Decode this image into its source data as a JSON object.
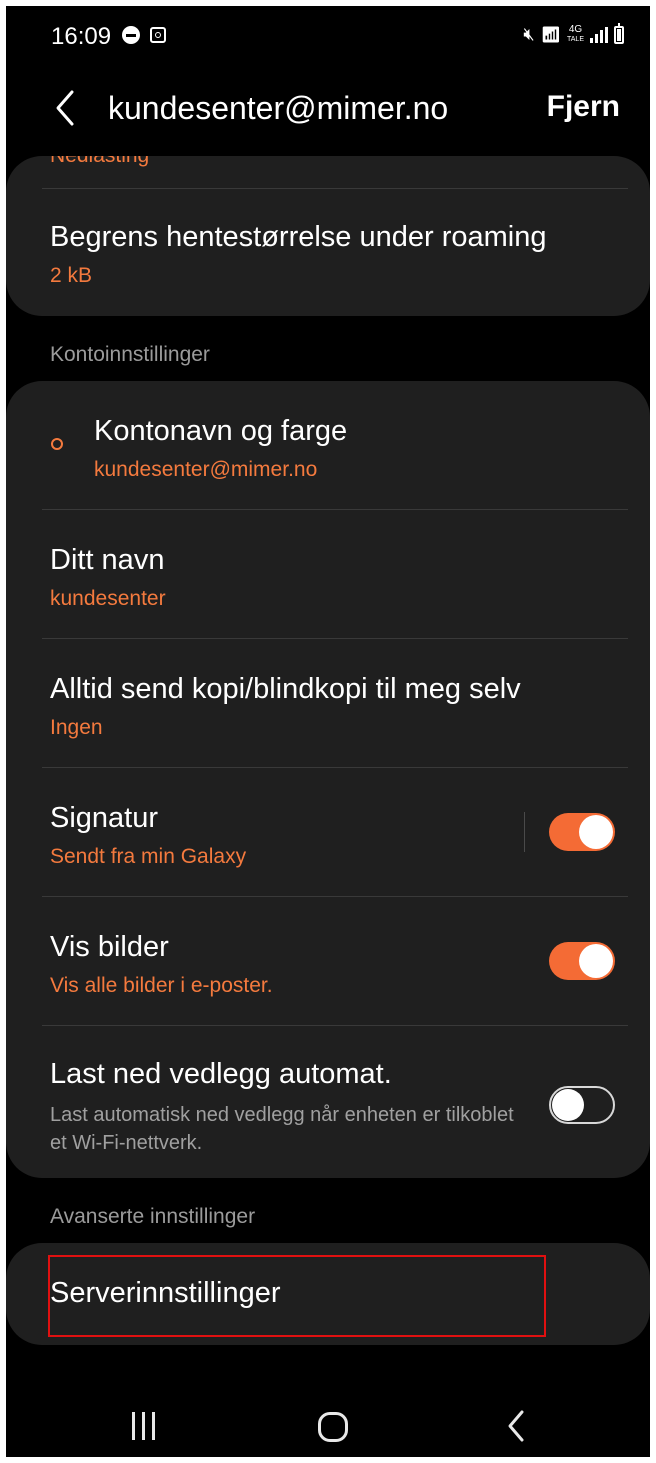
{
  "status_bar": {
    "time": "16:09",
    "network_label_top": "4G",
    "network_label_bottom": "TALE"
  },
  "header": {
    "title": "kundesenter@mimer.no",
    "remove_label": "Fjern"
  },
  "top_card": {
    "partial_row_text": "Nedlasting",
    "roaming_row": {
      "title": "Begrens hentestørrelse under roaming",
      "value": "2 kB"
    }
  },
  "account_section": {
    "header": "Kontoinnstillinger",
    "rows": [
      {
        "title": "Kontonavn og farge",
        "value": "kundesenter@mimer.no"
      },
      {
        "title": "Ditt navn",
        "value": "kundesenter"
      },
      {
        "title": "Alltid send kopi/blindkopi til meg selv",
        "value": "Ingen"
      },
      {
        "title": "Signatur",
        "value": "Sendt fra min Galaxy",
        "toggle": "on"
      },
      {
        "title": "Vis bilder",
        "value": "Vis alle bilder i e-poster.",
        "toggle": "on"
      },
      {
        "title": "Last ned vedlegg automat.",
        "value": "Last automatisk ned vedlegg når enheten er tilkoblet et Wi-Fi-nettverk.",
        "toggle": "off"
      }
    ]
  },
  "advanced_section": {
    "header": "Avanserte innstillinger",
    "server_settings_label": "Serverinnstillinger"
  },
  "colors": {
    "accent": "#f47a3e",
    "toggle_on": "#f46b35",
    "card_bg": "#1f1f1f",
    "highlight": "#e01010"
  }
}
